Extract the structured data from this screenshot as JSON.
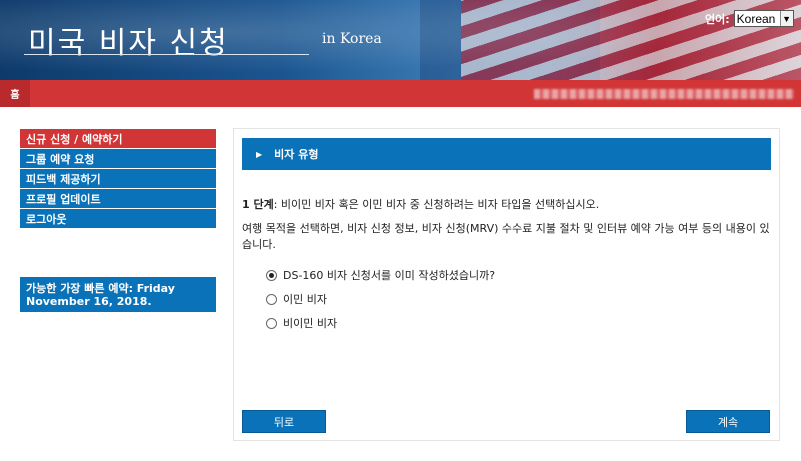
{
  "header": {
    "title": "미국 비자 신청",
    "subtitle": "in Korea",
    "language_label": "언어:",
    "language_selected": "Korean",
    "language_arrow": "▼"
  },
  "navbar": {
    "home_label": "홈"
  },
  "sidebar": {
    "items": [
      {
        "label": "신규 신청 / 예약하기",
        "active": true
      },
      {
        "label": "그룹 예약 요청",
        "active": false
      },
      {
        "label": "피드백 제공하기",
        "active": false
      },
      {
        "label": "프로필 업데이트",
        "active": false
      },
      {
        "label": "로그아웃",
        "active": false
      }
    ],
    "earliest_appointment": "가능한 가장 빠른 예약: Friday November 16, 2018."
  },
  "main": {
    "section_title": "비자 유형",
    "step_label": "1 단계",
    "step_text": ": 비이민 비자 혹은 이민 비자 중 신청하려는 비자 타입을 선택하십시오.",
    "description": "여행 목적을 선택하면, 비자 신청 정보, 비자 신청(MRV) 수수료 지불 절차 및 인터뷰 예약 가능 여부 등의 내용이 있습니다.",
    "options": [
      {
        "label": "DS-160 비자 신청서를 이미 작성하셨습니까?",
        "checked": true
      },
      {
        "label": "이민 비자",
        "checked": false
      },
      {
        "label": "비이민 비자",
        "checked": false
      }
    ],
    "back_button": "뒤로",
    "continue_button": "계속"
  },
  "colors": {
    "menu_blue": "#0a72b8",
    "nav_red": "#d13536"
  }
}
